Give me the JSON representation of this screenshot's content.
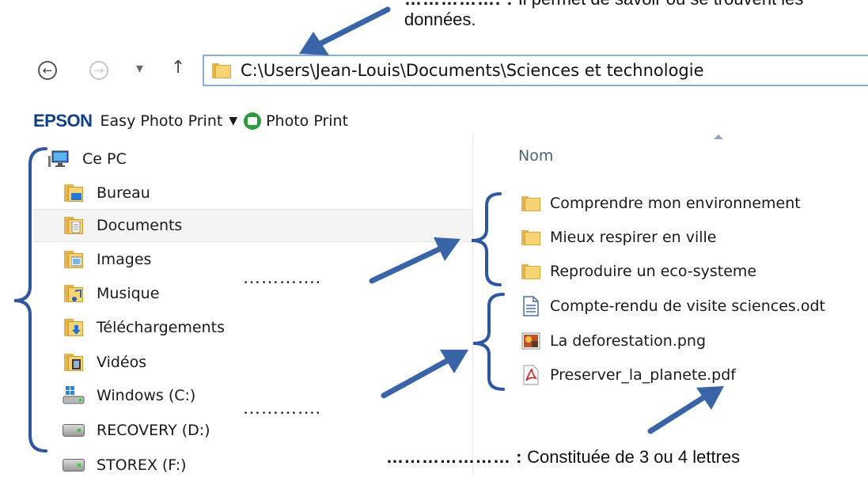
{
  "annotation_top": {
    "line1_dots": "……………. :",
    "line1_text": "Il permet de savoir où se trouvent les",
    "line2_text": "données."
  },
  "nav": {
    "back_glyph": "←",
    "forward_glyph": "→",
    "dropdown_glyph": "▾",
    "up_glyph": "↑",
    "address_path": "C:\\Users\\Jean-Louis\\Documents\\Sciences et technologie"
  },
  "toolbar": {
    "brand": "EPSON",
    "easy_photo_print": "Easy Photo Print",
    "dropdown_glyph": "▼",
    "photo_print": "Photo Print"
  },
  "sidebar": {
    "root": "Ce PC",
    "items": [
      {
        "label": "Bureau",
        "icon": "desktop-folder-icon"
      },
      {
        "label": "Documents",
        "icon": "documents-folder-icon",
        "selected": true
      },
      {
        "label": "Images",
        "icon": "images-folder-icon"
      },
      {
        "label": "Musique",
        "icon": "music-folder-icon"
      },
      {
        "label": "Téléchargements",
        "icon": "downloads-folder-icon"
      },
      {
        "label": "Vidéos",
        "icon": "videos-folder-icon"
      },
      {
        "label": "Windows (C:)",
        "icon": "windows-drive-icon"
      },
      {
        "label": "RECOVERY (D:)",
        "icon": "drive-icon"
      },
      {
        "label": "STOREX (F:)",
        "icon": "drive-icon"
      }
    ]
  },
  "files": {
    "column_header": "Nom",
    "folders": [
      "Comprendre mon environnement",
      "Mieux respirer en ville",
      "Reproduire un eco-systeme"
    ],
    "documents": [
      {
        "name": "Compte-rendu de visite sciences.odt",
        "icon": "odt-document-icon"
      },
      {
        "name": "La deforestation.png",
        "icon": "png-image-icon"
      },
      {
        "name": "Preserver_la_planete.pdf",
        "icon": "pdf-document-icon"
      }
    ]
  },
  "annotations": {
    "middle_dots_1": "………….",
    "middle_dots_2": "………….",
    "bottom_dots": "………………… :",
    "bottom_text": "Constituée de 3 ou 4 lettres"
  },
  "colors": {
    "annotation_blue": "#3a64a8",
    "brace_blue": "#2f56a0",
    "folder_yellow": "#f6d474",
    "address_border": "#8aaee0",
    "epson_blue": "#123f8a"
  }
}
